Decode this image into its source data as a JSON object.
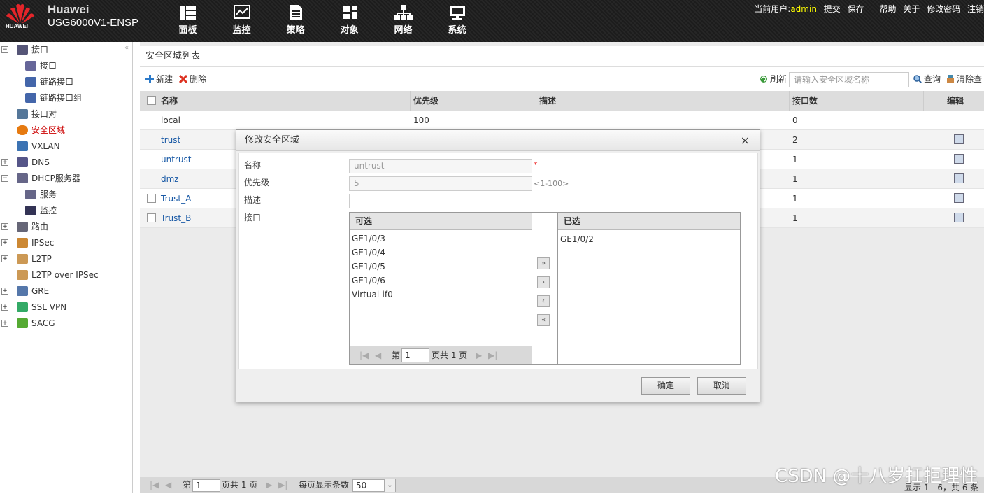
{
  "header": {
    "brand": "Huawei",
    "model": "USG6000V1-ENSP",
    "logo_text": "HUAWEI",
    "nav": [
      {
        "label": "面板",
        "icon": "dashboard-icon"
      },
      {
        "label": "监控",
        "icon": "monitor-chart-icon"
      },
      {
        "label": "策略",
        "icon": "policy-doc-icon"
      },
      {
        "label": "对象",
        "icon": "object-icon"
      },
      {
        "label": "网络",
        "icon": "network-icon"
      },
      {
        "label": "系统",
        "icon": "system-icon"
      }
    ],
    "top": {
      "current_user_label": "当前用户:",
      "user": "admin",
      "submit": "提交",
      "save": "保存",
      "help": "帮助",
      "about": "关于",
      "change_password": "修改密码",
      "logout": "注销"
    }
  },
  "sidebar": {
    "items": [
      {
        "label": "接口",
        "level": 0,
        "expander": "−"
      },
      {
        "label": "接口",
        "level": 1
      },
      {
        "label": "链路接口",
        "level": 1
      },
      {
        "label": "链路接口组",
        "level": 1
      },
      {
        "label": "接口对",
        "level": 0
      },
      {
        "label": "安全区域",
        "level": 0,
        "active": true
      },
      {
        "label": "VXLAN",
        "level": 0
      },
      {
        "label": "DNS",
        "level": 0,
        "expander": "+"
      },
      {
        "label": "DHCP服务器",
        "level": 0,
        "expander": "−"
      },
      {
        "label": "服务",
        "level": 1
      },
      {
        "label": "监控",
        "level": 1
      },
      {
        "label": "路由",
        "level": 0,
        "expander": "+"
      },
      {
        "label": "IPSec",
        "level": 0,
        "expander": "+"
      },
      {
        "label": "L2TP",
        "level": 0,
        "expander": "+"
      },
      {
        "label": "L2TP over IPSec",
        "level": 0
      },
      {
        "label": "GRE",
        "level": 0,
        "expander": "+"
      },
      {
        "label": "SSL VPN",
        "level": 0,
        "expander": "+"
      },
      {
        "label": "SACG",
        "level": 0,
        "expander": "+"
      }
    ]
  },
  "main": {
    "title": "安全区域列表",
    "toolbar": {
      "new": "新建",
      "delete": "删除",
      "refresh": "刷新",
      "search_placeholder": "请输入安全区域名称",
      "query": "查询",
      "clear": "清除查"
    },
    "columns": [
      "名称",
      "优先级",
      "描述",
      "接口数",
      "编辑"
    ],
    "rows": [
      {
        "name": "local",
        "priority": "100",
        "desc": "",
        "count": "0",
        "checkbox": false,
        "link": false,
        "edit": false
      },
      {
        "name": "trust",
        "priority": "",
        "desc": "",
        "count": "2",
        "checkbox": false,
        "link": true,
        "edit": true
      },
      {
        "name": "untrust",
        "priority": "",
        "desc": "",
        "count": "1",
        "checkbox": false,
        "link": true,
        "edit": true
      },
      {
        "name": "dmz",
        "priority": "",
        "desc": "",
        "count": "1",
        "checkbox": false,
        "link": true,
        "edit": true
      },
      {
        "name": "Trust_A",
        "priority": "",
        "desc": "",
        "count": "1",
        "checkbox": true,
        "link": true,
        "edit": true
      },
      {
        "name": "Trust_B",
        "priority": "",
        "desc": "",
        "count": "1",
        "checkbox": true,
        "link": true,
        "edit": true
      }
    ],
    "pager": {
      "page_prefix": "第",
      "page": "1",
      "page_suffix": "页共 1 页",
      "per_page_label": "每页显示条数",
      "per_page": "50",
      "summary": "显示 1 - 6，共 6 条"
    }
  },
  "dialog": {
    "title": "修改安全区域",
    "fields": {
      "name_label": "名称",
      "name_value": "untrust",
      "priority_label": "优先级",
      "priority_value": "5",
      "priority_hint": "<1-100>",
      "desc_label": "描述",
      "desc_value": "",
      "iface_label": "接口"
    },
    "available_title": "可选",
    "available": [
      "GE1/0/3",
      "GE1/0/4",
      "GE1/0/5",
      "GE1/0/6",
      "Virtual-if0"
    ],
    "selected_title": "已选",
    "selected": [
      "GE1/0/2"
    ],
    "list_pager": {
      "prefix": "第",
      "page": "1",
      "suffix": "页共 1 页"
    },
    "ok": "确定",
    "cancel": "取消"
  },
  "watermark": "CSDN @十八岁扛拒理性"
}
